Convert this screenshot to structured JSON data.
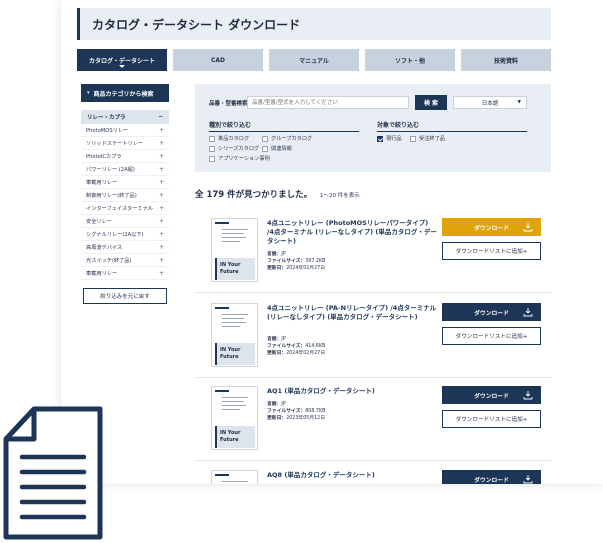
{
  "header": {
    "title": "カタログ・データシート ダウンロード"
  },
  "tabs": [
    {
      "label": "カタログ・データシート",
      "active": true
    },
    {
      "label": "CAD",
      "active": false
    },
    {
      "label": "マニュアル",
      "active": false
    },
    {
      "label": "ソフト・他",
      "active": false
    },
    {
      "label": "技術資料",
      "active": false
    }
  ],
  "sidebar": {
    "heading": "商品カテゴリから検索",
    "heading_icon": "chevron-down-icon",
    "subheading": "リレー・カプラ",
    "subheading_icon": "minus-icon",
    "items": [
      {
        "label": "PhotoMOSリレー"
      },
      {
        "label": "ソリッドステートリレー"
      },
      {
        "label": "PhotoICカプラ"
      },
      {
        "label": "パワーリレー (2A超)"
      },
      {
        "label": "車載用リレー"
      },
      {
        "label": "制御用リレー(終了品)"
      },
      {
        "label": "インターフェイスターミナル"
      },
      {
        "label": "安全リレー"
      },
      {
        "label": "シグナルリレー(2A以下)"
      },
      {
        "label": "高周波デバイス"
      },
      {
        "label": "光スイッチ(終了品)"
      },
      {
        "label": "車載用リレー"
      }
    ],
    "plus_symbol": "+",
    "reset_label": "絞り込みを元に戻す"
  },
  "search": {
    "label": "品番・型番検索",
    "placeholder": "品番/型番/型式を入力してください",
    "button": "検 索",
    "language": "日本語",
    "language_icon": "triangle-down-icon"
  },
  "filters": {
    "type_title": "種別で絞り込む",
    "type_options": [
      {
        "label": "単品カタログ",
        "checked": false
      },
      {
        "label": "グループカタログ",
        "checked": false
      },
      {
        "label": "シリーズカタログ",
        "checked": false
      },
      {
        "label": "関連情報",
        "checked": false
      },
      {
        "label": "アプリケーション事例",
        "checked": false
      }
    ],
    "target_title": "対象で絞り込む",
    "target_options": [
      {
        "label": "現行品",
        "checked": true
      },
      {
        "label": "受注終了品",
        "checked": false
      }
    ]
  },
  "results": {
    "count_text": "全 179 件が見つかりました。",
    "range_text": "1〜20 件を表示",
    "meta_labels": {
      "language": "言語：",
      "size": "ファイルサイズ：",
      "updated": "更新日："
    },
    "download_label": "ダウンロード",
    "add_label": "ダウンロードリストに追加+",
    "thumb_text": "IN Your\nFuture",
    "items": [
      {
        "title": "4点ユニットリレー (PhotoMOSリレーパワータイプ) /4点ターミナル (リレーなしタイプ) (単品カタログ・データシート)",
        "language": "JP",
        "size": "397.2KB",
        "updated": "2024年02月27日",
        "highlight": true
      },
      {
        "title": "4点ユニットリレー (PA-Nリレータイプ) /4点ターミナル (リレーなしタイプ) (単品カタログ・データシート)",
        "language": "JP",
        "size": "414.6KB",
        "updated": "2024年02月27日",
        "highlight": false
      },
      {
        "title": "AQ1 (単品カタログ・データシート)",
        "language": "JP",
        "size": "808.7KB",
        "updated": "2023年05月12日",
        "highlight": false
      },
      {
        "title": "AQ8 (単品カタログ・データシート)",
        "language": "",
        "size": "",
        "updated": "",
        "highlight": false
      }
    ]
  },
  "decor": {
    "icon": "document-icon",
    "color": "#1d3557"
  }
}
